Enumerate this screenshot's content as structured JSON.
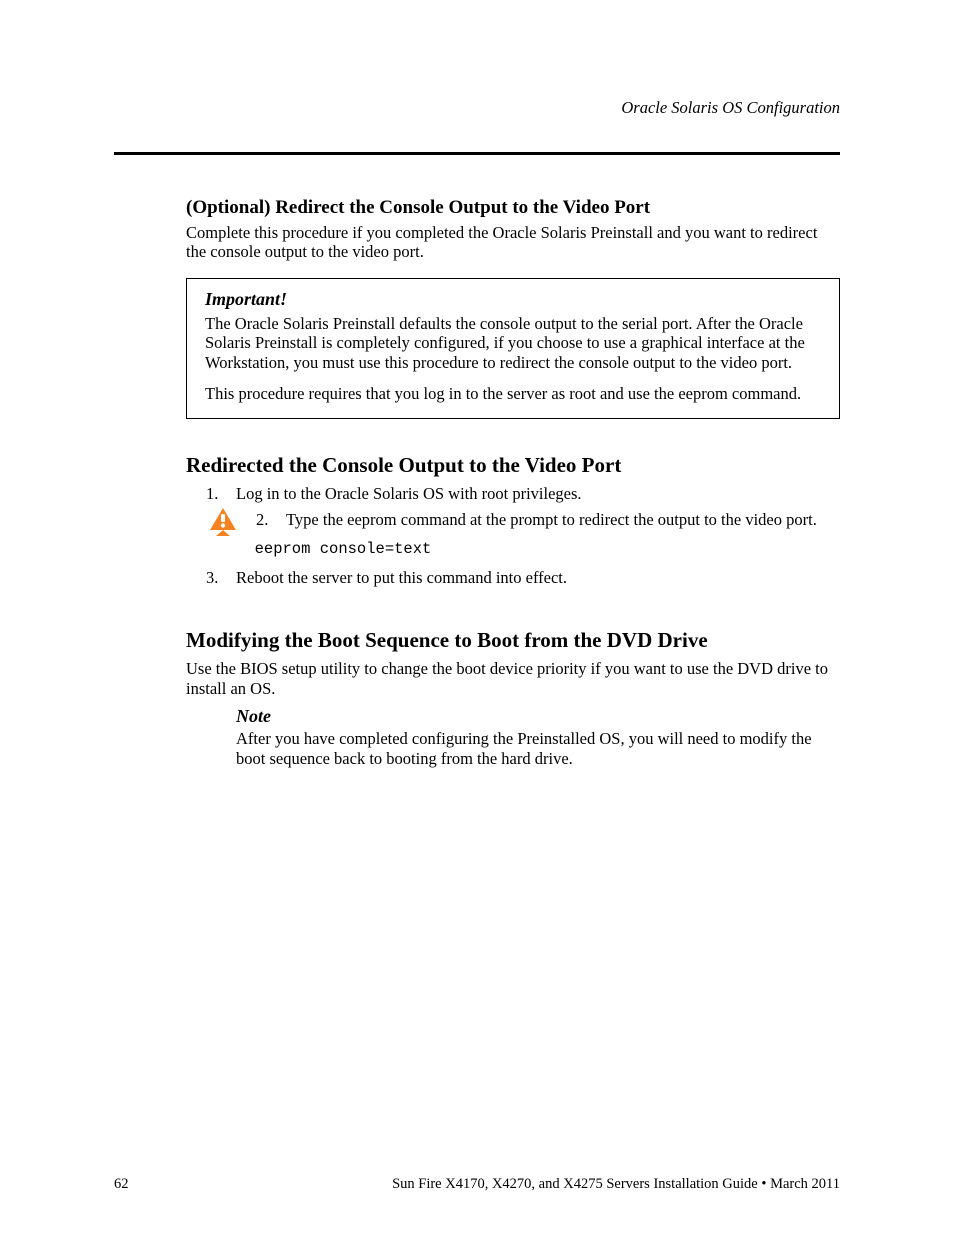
{
  "header": {
    "right": "Oracle Solaris OS Configuration"
  },
  "body": {
    "subhead": "(Optional) Redirect the Console Output to the Video Port",
    "intro": "Complete this procedure if you completed the Oracle Solaris Preinstall and you want to redirect the console output to the video port.",
    "important": {
      "title": "Important!",
      "p1": "The Oracle Solaris Preinstall defaults the console output to the serial port. After the Oracle Solaris Preinstall is completely configured, if you choose to use a graphical interface at the Workstation, you must use this procedure to redirect the console output to the video port.",
      "p2": "This procedure requires that you log in to the server as root and use the eeprom command."
    },
    "h3": "Redirected the Console Output to the Video Port",
    "steps": [
      "Log in to the Oracle Solaris OS with root privileges.",
      "Type the eeprom command at the prompt to redirect the output to the video port.",
      "Reboot the server to put this command into effect."
    ],
    "cmd_line": "  eeprom console=text",
    "section2": {
      "h3": "Modifying the Boot Sequence to Boot from the DVD Drive",
      "p": "Use the BIOS setup utility to change the boot device priority if you want to use the DVD drive to install an OS.",
      "note_title": "Note",
      "note_p": "After you have completed configuring the Preinstalled OS, you will need to modify the boot sequence back to booting from the hard drive."
    }
  },
  "footer": {
    "left": "62",
    "right": "Sun Fire X4170, X4270, and X4275 Servers Installation Guide • March 2011"
  }
}
